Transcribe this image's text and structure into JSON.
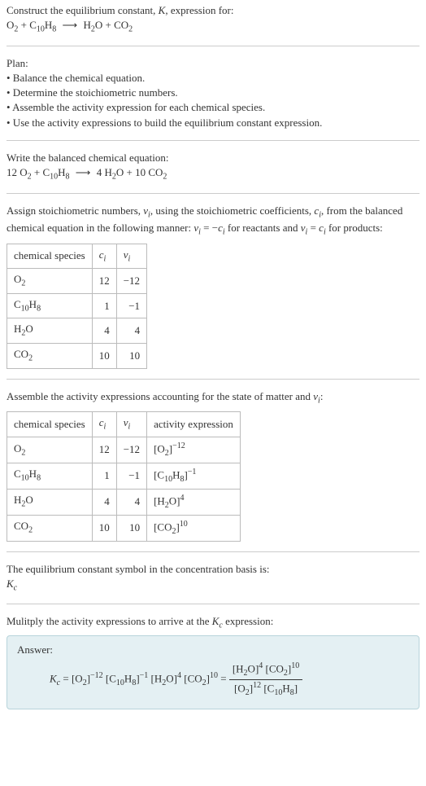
{
  "intro": {
    "line1": "Construct the equilibrium constant, ",
    "K": "K",
    "line1b": ", expression for:"
  },
  "eq_unbalanced": {
    "O2": "O",
    "O2_sub": "2",
    "plus1": " + ",
    "C10H8": "C",
    "C10H8_sub1": "10",
    "C10H8_mid": "H",
    "C10H8_sub2": "8",
    "arrow": "⟶",
    "H2O": "H",
    "H2O_sub": "2",
    "H2O_end": "O",
    "plus2": " + ",
    "CO2": "CO",
    "CO2_sub": "2"
  },
  "plan": {
    "title": "Plan:",
    "b1": "• Balance the chemical equation.",
    "b2": "• Determine the stoichiometric numbers.",
    "b3": "• Assemble the activity expression for each chemical species.",
    "b4": "• Use the activity expressions to build the equilibrium constant expression."
  },
  "balanced_prompt": "Write the balanced chemical equation:",
  "eq_balanced": {
    "c1": "12 ",
    "c2": "4 ",
    "c3": "10 "
  },
  "assign": {
    "p1": "Assign stoichiometric numbers, ",
    "nu": "ν",
    "nu_sub": "i",
    "p2": ", using the stoichiometric coefficients, ",
    "c": "c",
    "c_sub": "i",
    "p3": ", from the balanced chemical equation in the following manner: ",
    "rel1a": "ν",
    "rel1b": "i",
    "rel1c": " = −",
    "rel1d": "c",
    "rel1e": "i",
    "p4": " for reactants and ",
    "rel2a": "ν",
    "rel2b": "i",
    "rel2c": " = ",
    "rel2d": "c",
    "rel2e": "i",
    "p5": " for products:"
  },
  "table1": {
    "h1": "chemical species",
    "h2": "c",
    "h2_sub": "i",
    "h3": "ν",
    "h3_sub": "i",
    "rows": [
      {
        "sp_a": "O",
        "sp_sub1": "2",
        "sp_b": "",
        "sp_sub2": "",
        "c": "12",
        "nu": "−12"
      },
      {
        "sp_a": "C",
        "sp_sub1": "10",
        "sp_b": "H",
        "sp_sub2": "8",
        "c": "1",
        "nu": "−1"
      },
      {
        "sp_a": "H",
        "sp_sub1": "2",
        "sp_b": "O",
        "sp_sub2": "",
        "c": "4",
        "nu": "4"
      },
      {
        "sp_a": "CO",
        "sp_sub1": "2",
        "sp_b": "",
        "sp_sub2": "",
        "c": "10",
        "nu": "10"
      }
    ]
  },
  "assemble_prompt": {
    "p1": "Assemble the activity expressions accounting for the state of matter and ",
    "nu": "ν",
    "nu_sub": "i",
    "p2": ":"
  },
  "table2": {
    "h1": "chemical species",
    "h2": "c",
    "h2_sub": "i",
    "h3": "ν",
    "h3_sub": "i",
    "h4": "activity expression",
    "rows": [
      {
        "sp_a": "O",
        "sp_sub1": "2",
        "sp_b": "",
        "sp_sub2": "",
        "c": "12",
        "nu": "−12",
        "ae_open": "[O",
        "ae_sub": "2",
        "ae_close": "]",
        "ae_sup": "−12"
      },
      {
        "sp_a": "C",
        "sp_sub1": "10",
        "sp_b": "H",
        "sp_sub2": "8",
        "c": "1",
        "nu": "−1",
        "ae_open": "[C",
        "ae_sub": "10",
        "ae_mid": "H",
        "ae_sub2": "8",
        "ae_close": "]",
        "ae_sup": "−1"
      },
      {
        "sp_a": "H",
        "sp_sub1": "2",
        "sp_b": "O",
        "sp_sub2": "",
        "c": "4",
        "nu": "4",
        "ae_open": "[H",
        "ae_sub": "2",
        "ae_mid": "O",
        "ae_close": "]",
        "ae_sup": "4"
      },
      {
        "sp_a": "CO",
        "sp_sub1": "2",
        "sp_b": "",
        "sp_sub2": "",
        "c": "10",
        "nu": "10",
        "ae_open": "[CO",
        "ae_sub": "2",
        "ae_close": "]",
        "ae_sup": "10"
      }
    ]
  },
  "kc_line": {
    "p1": "The equilibrium constant symbol in the concentration basis is:",
    "Kc": "K",
    "Kc_sub": "c"
  },
  "mult_prompt": {
    "p1": "Mulitply the activity expressions to arrive at the ",
    "Kc": "K",
    "Kc_sub": "c",
    "p2": " expression:"
  },
  "answer": {
    "label": "Answer:",
    "Kc": "K",
    "Kc_sub": "c",
    "eq": " = ",
    "t1": "[O",
    "t1_sub": "2",
    "t1_close": "]",
    "t1_sup": "−12",
    "sp": " ",
    "t2": "[C",
    "t2_sub1": "10",
    "t2_mid": "H",
    "t2_sub2": "8",
    "t2_close": "]",
    "t2_sup": "−1",
    "t3": "[H",
    "t3_sub": "2",
    "t3_mid": "O",
    "t3_close": "]",
    "t3_sup": "4",
    "t4": "[CO",
    "t4_sub": "2",
    "t4_close": "]",
    "t4_sup": "10",
    "eq2": " = ",
    "num_a": "[H",
    "num_a_sub": "2",
    "num_a_mid": "O",
    "num_a_close": "]",
    "num_a_sup": "4",
    "num_b": "[CO",
    "num_b_sub": "2",
    "num_b_close": "]",
    "num_b_sup": "10",
    "den_a": "[O",
    "den_a_sub": "2",
    "den_a_close": "]",
    "den_a_sup": "12",
    "den_b": "[C",
    "den_b_sub1": "10",
    "den_b_mid": "H",
    "den_b_sub2": "8",
    "den_b_close": "]"
  }
}
